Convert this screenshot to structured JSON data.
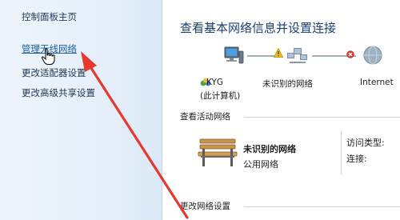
{
  "sidebar": {
    "items": [
      {
        "label": "控制面板主页"
      },
      {
        "label": "管理无线网络"
      },
      {
        "label": "更改适配器设置"
      },
      {
        "label": "更改高级共享设置"
      }
    ]
  },
  "main": {
    "title": "查看基本网络信息并设置连接",
    "map": {
      "computer_name": "KYG",
      "computer_sub": "(此计算机)",
      "network_label": "未识别的网络",
      "internet_label": "Internet"
    },
    "active_networks_header": "查看活动网络",
    "network": {
      "name": "未识别的网络",
      "type": "公用网络"
    },
    "access_type_label": "访问类型:",
    "connections_label": "连接:",
    "change_settings_header": "更改网络设置"
  },
  "icons": {
    "computer": "computer-icon",
    "network": "network-icon",
    "internet": "globe-icon",
    "warning": "warning-icon",
    "disconnect": "red-x-icon",
    "homegroup": "homegroup-icon",
    "bench": "public-network-bench-icon",
    "cursor": "hand-cursor-icon",
    "arrow": "red-arrow-icon"
  },
  "colors": {
    "link": "#1a5ea8",
    "title": "#1b3f78",
    "arrow": "#e8372d",
    "sidebar_bg": "#e4eef9"
  }
}
